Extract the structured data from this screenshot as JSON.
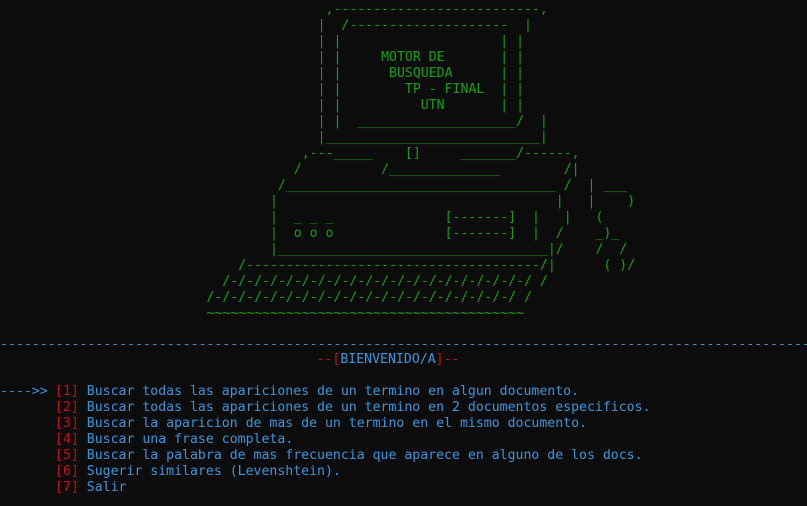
{
  "art_lines": [
    "                                         ,--------------------------,",
    "                                        |  /--------------------  |",
    "                                        | |                    | |",
    "                                        | |     MOTOR DE       | |",
    "                                        | |      BUSQUEDA      | |",
    "                                        | |        TP - FINAL  | |",
    "                                        | |          UTN       | |",
    "                                        | |  ____________________/  |",
    "                                        |___________________________|",
    "                                      ,---_____    []     _______/------,",
    "                                     /          /______________        /|",
    "                                   /__________________________________ /  | ___",
    "                                  |                                   |   |    )",
    "                                  |  _ _ _              [-------]  |   |   (",
    "                                  |  o o o              [-------]  |  /    _)_",
    "                                  |__________________________________|/    /  /",
    "                              /-------------------------------------/|      ( )/",
    "                            /-/-/-/-/-/-/-/-/-/-/-/-/-/-/-/-/-/-/-/ /",
    "                          /-/-/-/-/-/-/-/-/-/-/-/-/-/-/-/-/-/-/-/ /",
    "                          ~~~~~~~~~~~~~~~~~~~~~~~~~~~~~~~~~~~~~~~~"
  ],
  "divider": "------------------------------------------------------------------------------------------------------------------------",
  "welcome": {
    "left_dashes": "--",
    "open_bracket": "[",
    "text": "BIENVENIDO/A",
    "close_bracket": "]",
    "right_dashes": "--"
  },
  "menu": {
    "cursor": "---->>",
    "items": [
      {
        "number": "[1]",
        "label": "Buscar todas las apariciones de un termino en algun documento."
      },
      {
        "number": "[2]",
        "label": "Buscar todas las apariciones de un termino en 2 documentos especificos."
      },
      {
        "number": "[3]",
        "label": "Buscar la aparicion de mas de un termino en el mismo documento."
      },
      {
        "number": "[4]",
        "label": "Buscar una frase completa."
      },
      {
        "number": "[5]",
        "label": "Buscar la palabra de mas frecuencia que aparece en alguno de los docs."
      },
      {
        "number": "[6]",
        "label": "Sugerir similares (Levenshtein)."
      },
      {
        "number": "[7]",
        "label": "Salir"
      }
    ]
  },
  "colors": {
    "background": "#0c0c0c",
    "art_green": "#13a10e",
    "accent_blue": "#3a96dd",
    "accent_red": "#c50f1f"
  }
}
